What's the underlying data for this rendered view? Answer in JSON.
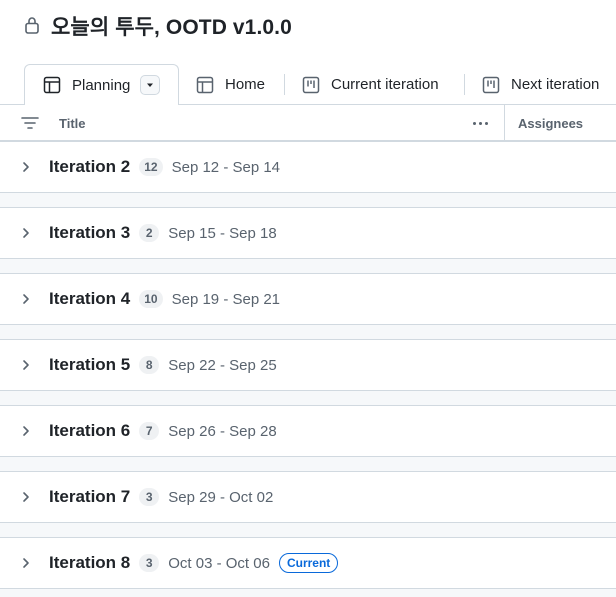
{
  "project": {
    "title": "오늘의 투두, OOTD v1.0.0",
    "icon": "lock-icon"
  },
  "tabs": [
    {
      "label": "Planning",
      "icon": "table-icon",
      "active": true
    },
    {
      "label": "Home",
      "icon": "table-icon",
      "active": false
    },
    {
      "label": "Current iteration",
      "icon": "board-icon",
      "active": false
    },
    {
      "label": "Next iteration",
      "icon": "board-icon",
      "active": false
    }
  ],
  "columns": {
    "title": "Title",
    "assignees": "Assignees"
  },
  "groups": [
    {
      "name": "Iteration 2",
      "count": "12",
      "dates": "Sep 12 - Sep 14",
      "badge": ""
    },
    {
      "name": "Iteration 3",
      "count": "2",
      "dates": "Sep 15 - Sep 18",
      "badge": ""
    },
    {
      "name": "Iteration 4",
      "count": "10",
      "dates": "Sep 19 - Sep 21",
      "badge": ""
    },
    {
      "name": "Iteration 5",
      "count": "8",
      "dates": "Sep 22 - Sep 25",
      "badge": ""
    },
    {
      "name": "Iteration 6",
      "count": "7",
      "dates": "Sep 26 - Sep 28",
      "badge": ""
    },
    {
      "name": "Iteration 7",
      "count": "3",
      "dates": "Sep 29 - Oct 02",
      "badge": ""
    },
    {
      "name": "Iteration 8",
      "count": "3",
      "dates": "Oct 03 - Oct 06",
      "badge": "Current"
    }
  ],
  "colors": {
    "accent": "#0969da",
    "border": "#d1d9e0",
    "muted_text": "#59636e"
  }
}
